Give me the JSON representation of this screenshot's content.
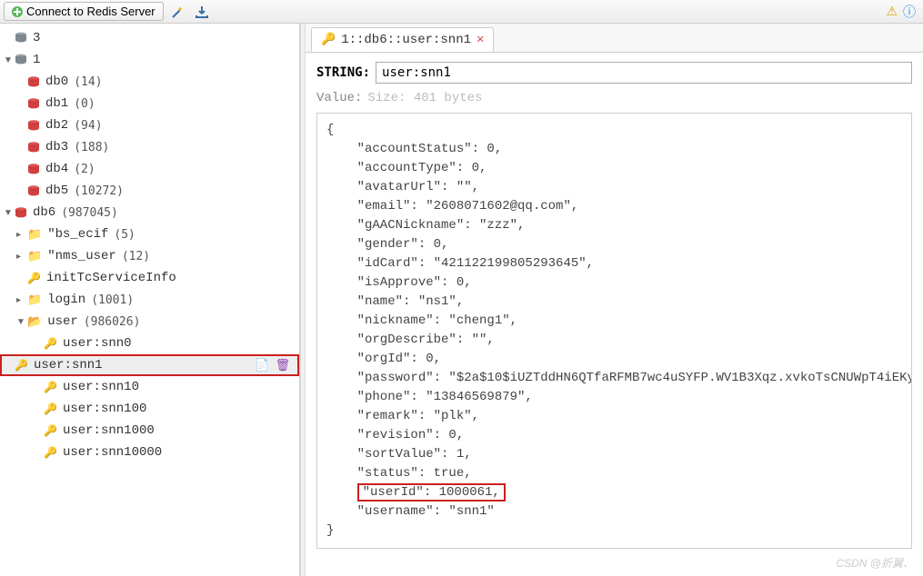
{
  "toolbar": {
    "connect_label": "Connect to Redis Server"
  },
  "tree": {
    "server_3": "3",
    "server_1": "1",
    "dbs": [
      {
        "name": "db0",
        "count": "(14)"
      },
      {
        "name": "db1",
        "count": "(0)"
      },
      {
        "name": "db2",
        "count": "(94)"
      },
      {
        "name": "db3",
        "count": "(188)"
      },
      {
        "name": "db4",
        "count": "(2)"
      },
      {
        "name": "db5",
        "count": "(10272)"
      }
    ],
    "db6": {
      "name": "db6",
      "count": "(987045)"
    },
    "db6_children": [
      {
        "type": "folder",
        "name": "bs_ecif",
        "count": "(5)",
        "leading": "\""
      },
      {
        "type": "folder",
        "name": "nms_user",
        "count": "(12)",
        "leading": "\""
      },
      {
        "type": "key",
        "name": "initTcServiceInfo"
      },
      {
        "type": "folder",
        "name": "login",
        "count": "(1001)"
      },
      {
        "type": "folder_open",
        "name": "user",
        "count": "(986026)"
      }
    ],
    "user_keys": [
      "user:snn0",
      "user:snn1",
      "user:snn10",
      "user:snn100",
      "user:snn1000",
      "user:snn10000"
    ],
    "selected": "user:snn1"
  },
  "tab": {
    "title": "1::db6::user:snn1"
  },
  "detail": {
    "type_label": "STRING:",
    "key_value": "user:snn1",
    "value_label": "Value:",
    "size_hint": "Size: 401 bytes"
  },
  "json_fields": {
    "accountStatus": "0",
    "accountType": "0",
    "avatarUrl": "\"\"",
    "email": "\"2608071602@qq.com\"",
    "gAACNickname": "\"zzz\"",
    "gender": "0",
    "idCard": "\"421122199805293645\"",
    "isApprove": "0",
    "name": "\"ns1\"",
    "nickname": "\"cheng1\"",
    "orgDescribe": "\"\"",
    "orgId": "0",
    "password": "\"$2a$10$iUZTddHN6QTfaRFMB7wc4uSYFP.WV1B3Xqz.xvkoTsCNUWpT4iEKy\"",
    "phone": "\"13846569879\"",
    "remark": "\"plk\"",
    "revision": "0",
    "sortValue": "1",
    "status": "true",
    "userId": "1000061",
    "username": "\"snn1\""
  },
  "highlight_key": "userId",
  "watermark": "CSDN @折翼、"
}
